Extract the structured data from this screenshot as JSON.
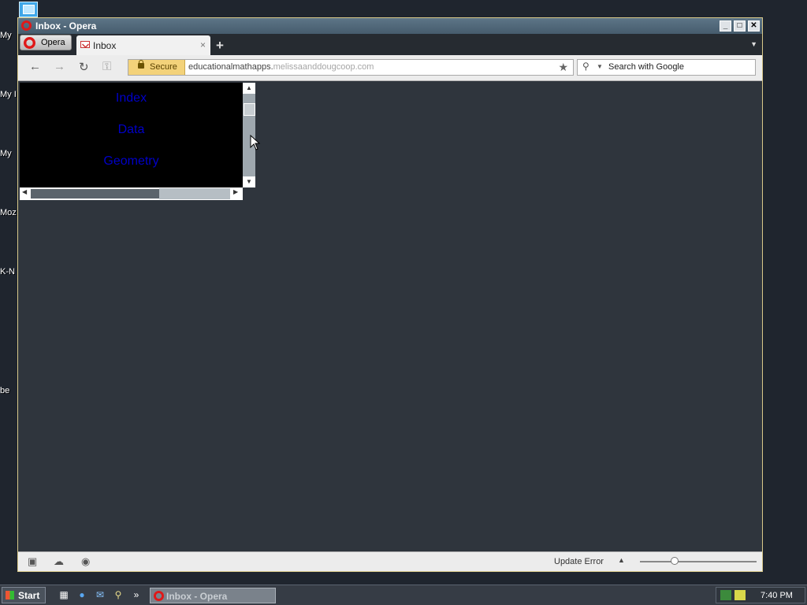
{
  "desktop": {
    "icons": [
      {
        "label": "My",
        "name": "desktop-icon-my-1"
      },
      {
        "label": "My I",
        "name": "desktop-icon-my-2"
      },
      {
        "label": "My",
        "name": "desktop-icon-my-3"
      },
      {
        "label": "Moz",
        "name": "desktop-icon-moz"
      },
      {
        "label": "K-N",
        "name": "desktop-icon-kn"
      },
      {
        "label": "be",
        "name": "desktop-icon-be"
      }
    ]
  },
  "window": {
    "title": "Inbox - Opera",
    "controls": {
      "minimize": "_",
      "maximize": "□",
      "close": "✕"
    }
  },
  "tabstrip": {
    "menu_label": "Opera",
    "tabs": [
      {
        "label": "Inbox",
        "close": "×"
      }
    ],
    "new_tab": "+",
    "menu_arrow": "▼"
  },
  "navbar": {
    "back": "←",
    "forward": "→",
    "reload": "↻",
    "key": "⚿",
    "secure_label": "Secure",
    "url_main": "educationalmathapps.",
    "url_rest": "melissaanddougcoop.com",
    "bookmark_star": "★",
    "search_placeholder": "Search with Google"
  },
  "frame": {
    "links": [
      "Index",
      "Data",
      "Geometry"
    ],
    "scroll_up": "▲",
    "scroll_down": "▼",
    "scroll_left": "◀",
    "scroll_right": "▶"
  },
  "statusbar": {
    "update_text": "Update Error",
    "arrow": "▲",
    "zoom_level": 0.3
  },
  "taskbar": {
    "start_label": "Start",
    "more": "»",
    "task_label": "Inbox - Opera",
    "clock": "7:40 PM"
  },
  "colors": {
    "link": "#0000c8",
    "window_bg": "#2f353d",
    "title_bar": "#5d7587"
  }
}
